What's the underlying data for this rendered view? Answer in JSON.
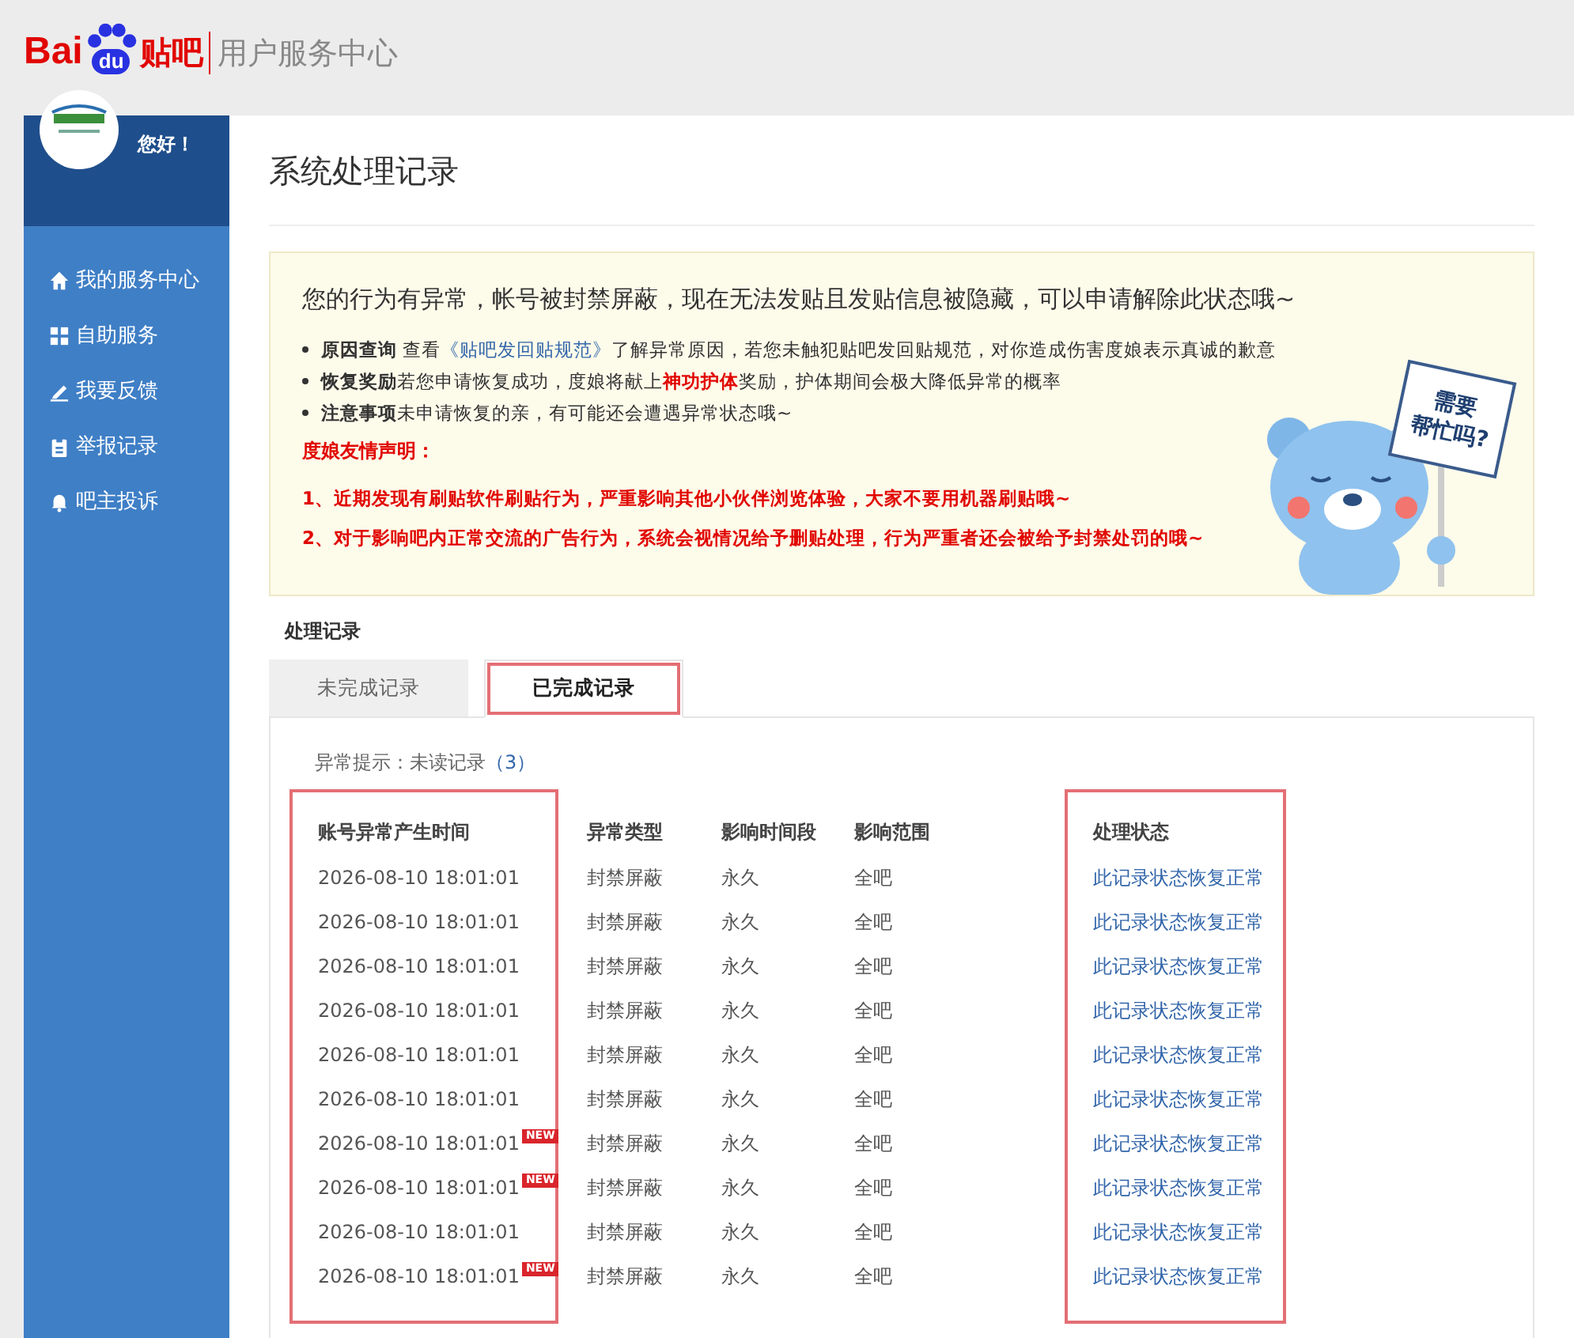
{
  "header": {
    "logo_text": "Bai",
    "logo_paw_text": "du",
    "logo_product": "贴吧",
    "subtitle": "用户服务中心"
  },
  "sidebar": {
    "greeting": "您好！",
    "items": [
      {
        "label": "我的服务中心",
        "selected": false
      },
      {
        "label": "自助服务",
        "selected": false
      },
      {
        "label": "我要反馈",
        "selected": false
      },
      {
        "label": "举报记录",
        "selected": false
      },
      {
        "label": "吧主投诉",
        "selected": false
      }
    ]
  },
  "page_title": "系统处理记录",
  "notice": {
    "headline": "您的行为有异常，帐号被封禁屏蔽，现在无法发贴且发贴信息被隐藏，可以申请解除此状态哦~",
    "bullets": [
      {
        "title": "原因查询",
        "parts": [
          {
            "text": " 查看",
            "kind": "plain"
          },
          {
            "text": "《贴吧发回贴规范》",
            "kind": "link"
          },
          {
            "text": "了解异常原因，若您未触犯贴吧发回贴规范，对你造成伤害度娘表示真诚的歉意",
            "kind": "plain"
          }
        ]
      },
      {
        "title": "恢复奖励",
        "parts": [
          {
            "text": "若您申请恢复成功，度娘将献上",
            "kind": "plain"
          },
          {
            "text": "神功护体",
            "kind": "emphasis"
          },
          {
            "text": "奖励，护体期间会极大降低异常的概率",
            "kind": "plain"
          }
        ]
      },
      {
        "title": "注意事项",
        "parts": [
          {
            "text": "未申请恢复的亲，有可能还会遭遇异常状态哦~",
            "kind": "plain"
          }
        ]
      }
    ],
    "statement_title": "度娘友情声明：",
    "statements": [
      "1、近期发现有刷贴软件刷贴行为，严重影响其他小伙伴浏览体验，大家不要用机器刷贴哦~",
      "2、对于影响吧内正常交流的广告行为，系统会视情况给予删贴处理，行为严重者还会被给予封禁处罚的哦~"
    ],
    "mascot_sign": [
      "需要",
      "帮忙吗?"
    ]
  },
  "records": {
    "section_title": "处理记录",
    "tabs": [
      {
        "label": "未完成记录",
        "selected": false,
        "highlighted": false
      },
      {
        "label": "已完成记录",
        "selected": true,
        "highlighted": true
      }
    ],
    "hint_label": "异常提示：未读记录",
    "hint_count": "（3）",
    "columns": [
      {
        "label": "账号异常产生时间",
        "highlighted": true
      },
      {
        "label": "异常类型",
        "highlighted": false
      },
      {
        "label": "影响时间段",
        "highlighted": false
      },
      {
        "label": "影响范围",
        "highlighted": false
      },
      {
        "label": "处理状态",
        "highlighted": true
      }
    ],
    "rows": [
      {
        "time": "2026-08-10 18:01:01",
        "type": "封禁屏蔽",
        "period": "永久",
        "scope": "全吧",
        "status": "此记录状态恢复正常"
      },
      {
        "time": "2026-08-10 18:01:01",
        "type": "封禁屏蔽",
        "period": "永久",
        "scope": "全吧",
        "status": "此记录状态恢复正常"
      },
      {
        "time": "2026-08-10 18:01:01",
        "type": "封禁屏蔽",
        "period": "永久",
        "scope": "全吧",
        "status": "此记录状态恢复正常"
      },
      {
        "time": "2026-08-10 18:01:01",
        "type": "封禁屏蔽",
        "period": "永久",
        "scope": "全吧",
        "status": "此记录状态恢复正常"
      },
      {
        "time": "2026-08-10 18:01:01",
        "type": "封禁屏蔽",
        "period": "永久",
        "scope": "全吧",
        "status": "此记录状态恢复正常"
      },
      {
        "time": "2026-08-10 18:01:01",
        "type": "封禁屏蔽",
        "period": "永久",
        "scope": "全吧",
        "status": "此记录状态恢复正常"
      },
      {
        "time": "2026-08-10 18:01:01",
        "badge": "NEW",
        "type": "封禁屏蔽",
        "period": "永久",
        "scope": "全吧",
        "status": "此记录状态恢复正常"
      },
      {
        "time": "2026-08-10 18:01:01",
        "badge": "NEW",
        "type": "封禁屏蔽",
        "period": "永久",
        "scope": "全吧",
        "status": "此记录状态恢复正常"
      },
      {
        "time": "2026-08-10 18:01:01",
        "type": "封禁屏蔽",
        "period": "永久",
        "scope": "全吧",
        "status": "此记录状态恢复正常"
      },
      {
        "time": "2026-08-10 18:01:01",
        "badge": "NEW",
        "type": "封禁屏蔽",
        "period": "永久",
        "scope": "全吧",
        "status": "此记录状态恢复正常"
      }
    ]
  }
}
